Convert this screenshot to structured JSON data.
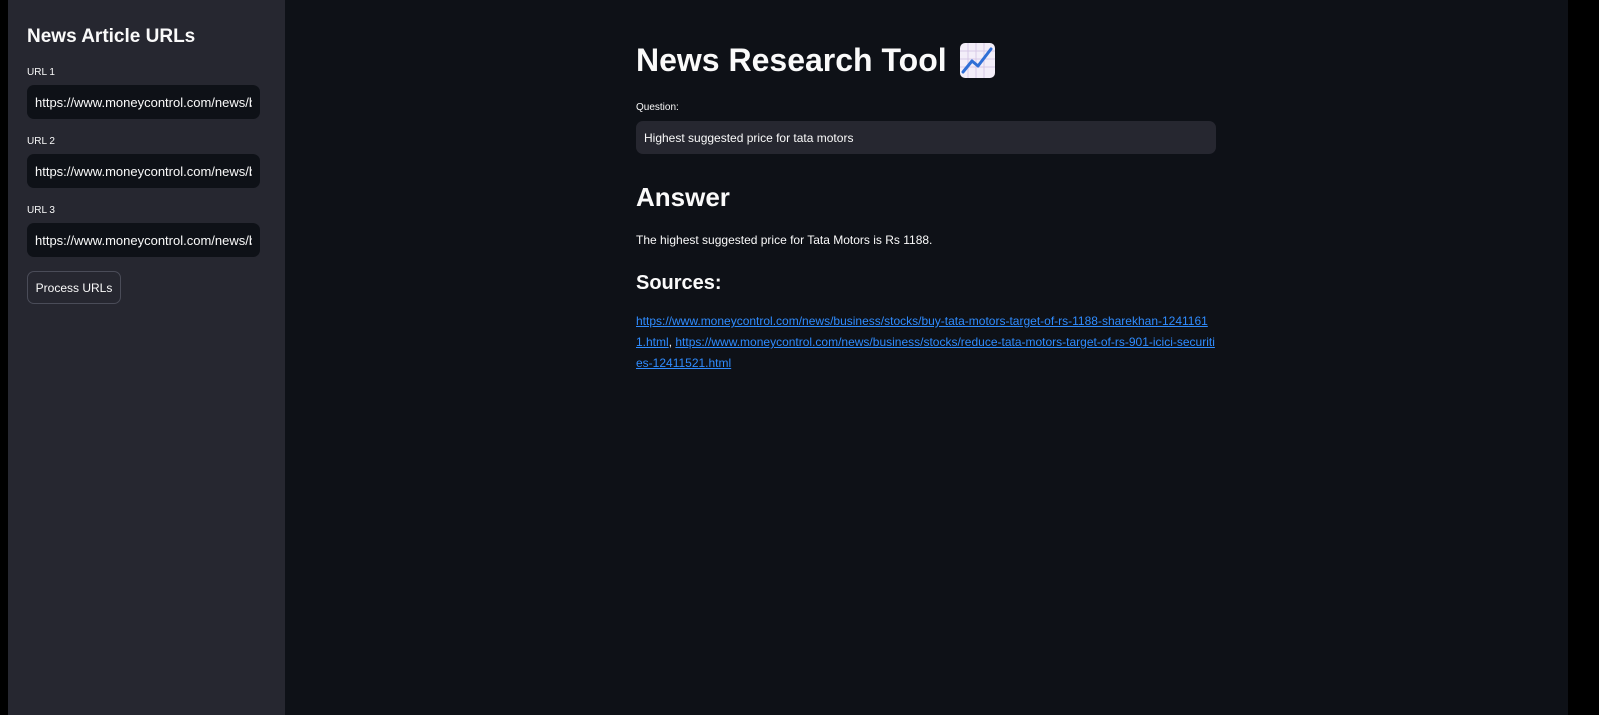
{
  "sidebar": {
    "title": "News Article URLs",
    "urls": [
      {
        "label": "URL 1",
        "value": "https://www.moneycontrol.com/news/b"
      },
      {
        "label": "URL 2",
        "value": "https://www.moneycontrol.com/news/b"
      },
      {
        "label": "URL 3",
        "value": "https://www.moneycontrol.com/news/b"
      }
    ],
    "process_button": "Process URLs"
  },
  "main": {
    "title": "News Research Tool",
    "title_icon": "chart-increasing-icon",
    "question_label": "Question:",
    "question_value": "Highest suggested price for tata motors",
    "answer_heading": "Answer",
    "answer_text": "The highest suggested price for Tata Motors is Rs 1188.",
    "sources_heading": "Sources:",
    "sources": [
      "https://www.moneycontrol.com/news/business/stocks/buy-tata-motors-target-of-rs-1188-sharekhan-12411611.html",
      "https://www.moneycontrol.com/news/business/stocks/reduce-tata-motors-target-of-rs-901-icici-securities-12411521.html"
    ],
    "sources_separator": ", "
  },
  "colors": {
    "app_background": "#0e1117",
    "sidebar_background": "#262730",
    "text": "#fafafa",
    "link": "#2f8cff"
  }
}
